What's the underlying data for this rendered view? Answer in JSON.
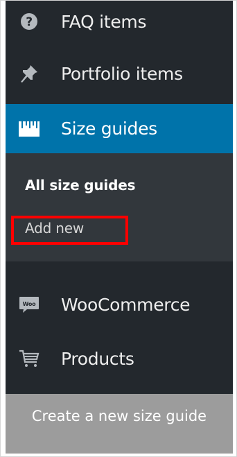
{
  "menu": {
    "items": [
      {
        "label": "FAQ items",
        "icon": "question-circle-icon"
      },
      {
        "label": "Portfolio items",
        "icon": "pin-icon"
      },
      {
        "label": "Size guides",
        "icon": "ruler-icon",
        "active": true
      },
      {
        "label": "WooCommerce",
        "icon": "woo-icon"
      },
      {
        "label": "Products",
        "icon": "cart-icon"
      }
    ],
    "submenu": {
      "current": "All size guides",
      "add_new": "Add new"
    }
  },
  "caption": "Create a new size guide",
  "colors": {
    "menu_bg": "#23282d",
    "submenu_bg": "#32373c",
    "active_bg": "#0073aa",
    "highlight": "#ff0000",
    "caption_bg": "#9c9c9c"
  }
}
